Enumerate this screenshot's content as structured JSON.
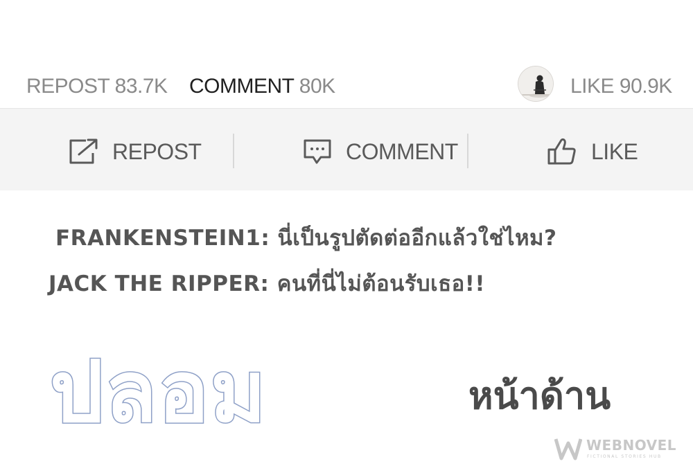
{
  "stats": {
    "repost_label": "REPOST",
    "repost_count": "83.7K",
    "comment_label": "COMMENT",
    "comment_count": "80K",
    "like_label": "LIKE",
    "like_count": "90.9K"
  },
  "actions": {
    "repost": "REPOST",
    "comment": "COMMENT",
    "like": "LIKE"
  },
  "comments": [
    {
      "user": "FRANKENSTEIN1:",
      "text": "นี่เป็นรูปตัดต่ออีกแล้วใช่ไหม?"
    },
    {
      "user": "JACK THE RIPPER:",
      "text": "คนที่นี่ไม่ต้อนรับเธอ!!"
    }
  ],
  "overlay": {
    "left_word": "ปลอม",
    "right_word": "หน้าด้าน"
  },
  "watermark": {
    "name": "WEBNOVEL",
    "tagline": "FICTIONAL STORIES HUB"
  },
  "icons": {
    "repost": "share-out-icon",
    "comment": "speech-bubble-icon",
    "like": "thumbs-up-icon"
  },
  "colors": {
    "muted_text": "#8a8a8a",
    "active_text": "#1f1f1f",
    "action_bar_bg": "#f4f4f4",
    "overlay_outline": "#8ea0c7"
  }
}
